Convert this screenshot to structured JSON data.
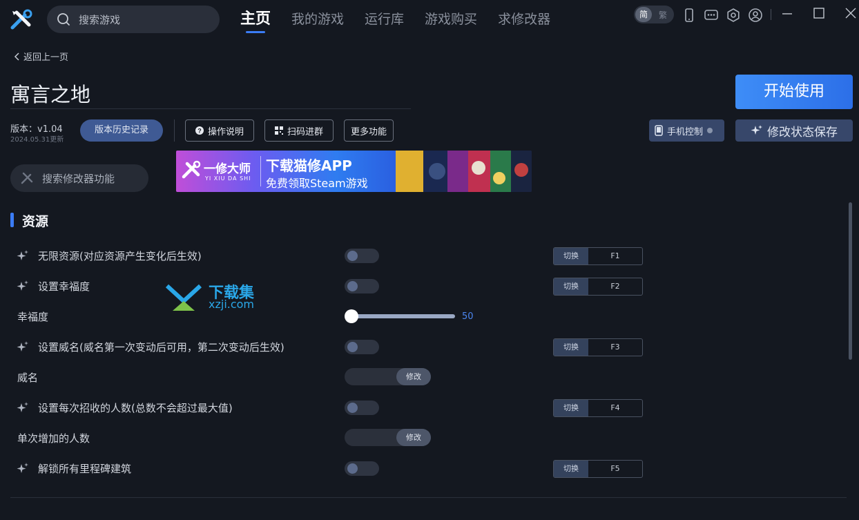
{
  "header": {
    "search_placeholder": "搜索游戏",
    "tabs": [
      {
        "label": "主页",
        "active": true
      },
      {
        "label": "我的游戏",
        "active": false
      },
      {
        "label": "运行库",
        "active": false
      },
      {
        "label": "游戏购买",
        "active": false
      },
      {
        "label": "求修改器",
        "active": false
      }
    ],
    "lang_simplified": "简",
    "lang_traditional": "繁"
  },
  "page": {
    "back_label": "返回上一页",
    "game_title": "寓言之地",
    "start_button": "开始使用",
    "version": "版本：v1.04",
    "updated": "2024.05.31更新",
    "history_button": "版本历史记录",
    "help_button": "操作说明",
    "scan_button": "扫码进群",
    "more_button": "更多功能",
    "phone_button": "手机控制",
    "save_button": "修改状态保存",
    "feature_search_placeholder": "搜索修改器功能"
  },
  "banner": {
    "brand_cn": "一修大师",
    "brand_en": "YI XIU DA SHI",
    "headline": "下载猫修APP",
    "subline": "免费领取Steam游戏"
  },
  "section": {
    "title": "资源"
  },
  "rows": [
    {
      "label": "无限资源(对应资源产生变化后生效)",
      "type": "toggle",
      "on": false,
      "switch_label": "切换",
      "hotkey": "F1"
    },
    {
      "label": "设置幸福度",
      "type": "toggle",
      "on": false,
      "switch_label": "切换",
      "hotkey": "F2"
    },
    {
      "label": "幸福度",
      "type": "slider",
      "value": "50",
      "fraction": 0.0
    },
    {
      "label": "设置威名(威名第一次变动后可用，第二次变动后生效)",
      "type": "toggle",
      "on": false,
      "switch_label": "切换",
      "hotkey": "F3"
    },
    {
      "label": "威名",
      "type": "edit",
      "edit_label": "修改"
    },
    {
      "label": "设置每次招收的人数(总数不会超过最大值)",
      "type": "toggle",
      "on": false,
      "switch_label": "切换",
      "hotkey": "F4"
    },
    {
      "label": "单次增加的人数",
      "type": "edit",
      "edit_label": "修改"
    },
    {
      "label": "解锁所有里程碑建筑",
      "type": "toggle",
      "on": false,
      "switch_label": "切换",
      "hotkey": "F5"
    }
  ],
  "watermark": {
    "cn": "下载集",
    "en": "xzji.com"
  },
  "colors": {
    "accent": "#3b7cf5",
    "background": "#141820"
  }
}
